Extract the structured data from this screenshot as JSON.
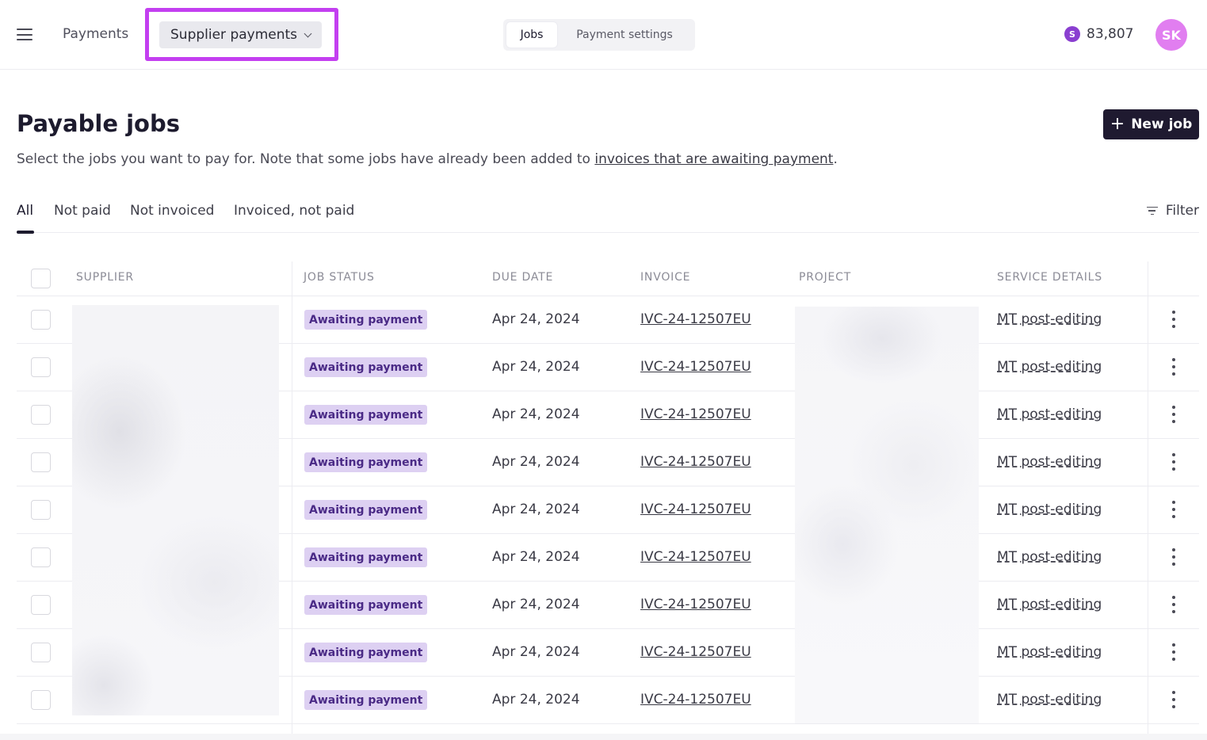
{
  "topbar": {
    "menu_icon": "hamburger-icon",
    "breadcrumb_root": "Payments",
    "section": "Supplier payments",
    "tabs": [
      {
        "label": "Jobs",
        "active": true
      },
      {
        "label": "Payment settings",
        "active": false
      }
    ],
    "credits_icon_letter": "S",
    "credits": "83,807",
    "avatar_initials": "SK",
    "highlight_color": "#c33ff0"
  },
  "header": {
    "title": "Payable jobs",
    "subtitle_prefix": "Select the jobs you want to pay for. Note that some jobs have already been added to ",
    "subtitle_link": "invoices that are awaiting payment",
    "subtitle_suffix": ".",
    "new_job_label": "New job"
  },
  "filters": {
    "tabs": [
      "All",
      "Not paid",
      "Not invoiced",
      "Invoiced, not paid"
    ],
    "active_tab": "All",
    "filter_label": "Filter"
  },
  "table": {
    "columns": [
      "SUPPLIER",
      "JOB STATUS",
      "DUE DATE",
      "INVOICE",
      "PROJECT",
      "SERVICE DETAILS"
    ],
    "rows": [
      {
        "status": "Awaiting payment",
        "due_date": "Apr 24, 2024",
        "invoice": "IVC-24-12507EU",
        "service": "MT post-editing"
      },
      {
        "status": "Awaiting payment",
        "due_date": "Apr 24, 2024",
        "invoice": "IVC-24-12507EU",
        "service": "MT post-editing"
      },
      {
        "status": "Awaiting payment",
        "due_date": "Apr 24, 2024",
        "invoice": "IVC-24-12507EU",
        "service": "MT post-editing"
      },
      {
        "status": "Awaiting payment",
        "due_date": "Apr 24, 2024",
        "invoice": "IVC-24-12507EU",
        "service": "MT post-editing"
      },
      {
        "status": "Awaiting payment",
        "due_date": "Apr 24, 2024",
        "invoice": "IVC-24-12507EU",
        "service": "MT post-editing"
      },
      {
        "status": "Awaiting payment",
        "due_date": "Apr 24, 2024",
        "invoice": "IVC-24-12507EU",
        "service": "MT post-editing"
      },
      {
        "status": "Awaiting payment",
        "due_date": "Apr 24, 2024",
        "invoice": "IVC-24-12507EU",
        "service": "MT post-editing"
      },
      {
        "status": "Awaiting payment",
        "due_date": "Apr 24, 2024",
        "invoice": "IVC-24-12507EU",
        "service": "MT post-editing"
      },
      {
        "status": "Awaiting payment",
        "due_date": "Apr 24, 2024",
        "invoice": "IVC-24-12507EU",
        "service": "MT post-editing"
      }
    ]
  },
  "colors": {
    "badge_bg": "#ddd0f2",
    "badge_text": "#4a2a86",
    "primary_button": "#1f1a30",
    "avatar": "#e17ef0",
    "coin": "#8a3fd0"
  }
}
